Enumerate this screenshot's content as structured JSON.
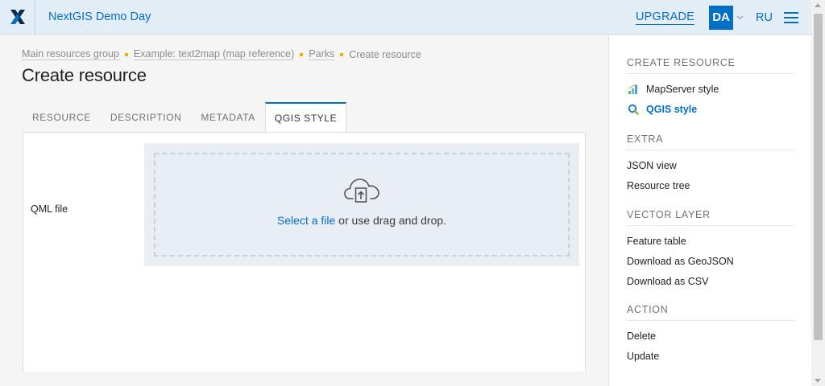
{
  "header": {
    "logo_icon": "nextgis-x-logo-icon",
    "title": "NextGIS Demo Day",
    "upgrade_label": "UPGRADE",
    "avatar_initials": "DA",
    "language": "RU",
    "menu_icon": "hamburger-menu-icon",
    "accent_color": "#0070c5"
  },
  "breadcrumb": {
    "items": [
      "Main resources group",
      "Example: text2map (map reference)",
      "Parks"
    ],
    "current": "Create resource"
  },
  "page": {
    "title": "Create resource"
  },
  "tabs": [
    {
      "label": "RESOURCE",
      "active": false
    },
    {
      "label": "DESCRIPTION",
      "active": false
    },
    {
      "label": "METADATA",
      "active": false
    },
    {
      "label": "QGIS STYLE",
      "active": true
    }
  ],
  "form": {
    "qml_label": "QML file",
    "upload_icon": "cloud-upload-icon",
    "select_link": "Select a file",
    "drop_text": " or use drag and drop."
  },
  "sidebar": {
    "create": {
      "heading": "CREATE RESOURCE",
      "items": [
        {
          "label": "MapServer style",
          "icon": "mapserver-style-icon",
          "active": false
        },
        {
          "label": "QGIS style",
          "icon": "qgis-style-icon",
          "active": true
        }
      ]
    },
    "extra": {
      "heading": "EXTRA",
      "items": [
        {
          "label": "JSON view"
        },
        {
          "label": "Resource tree"
        }
      ]
    },
    "vector": {
      "heading": "VECTOR LAYER",
      "items": [
        {
          "label": "Feature table"
        },
        {
          "label": "Download as GeoJSON"
        },
        {
          "label": "Download as CSV"
        }
      ]
    },
    "action": {
      "heading": "ACTION",
      "items": [
        {
          "label": "Delete"
        },
        {
          "label": "Update"
        }
      ]
    }
  }
}
